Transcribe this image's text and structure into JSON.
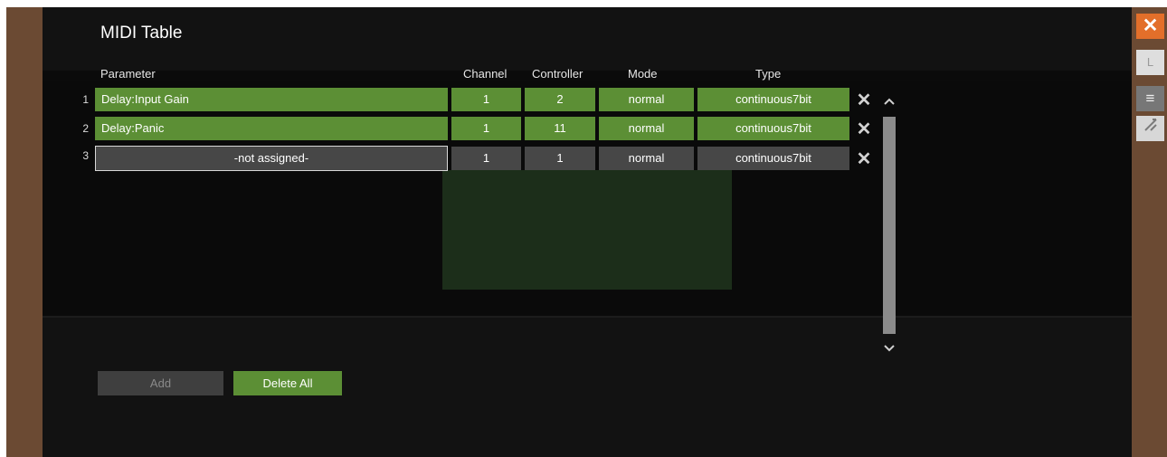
{
  "window": {
    "title": "MIDI Table"
  },
  "columns": {
    "parameter": "Parameter",
    "channel": "Channel",
    "controller": "Controller",
    "mode": "Mode",
    "type": "Type"
  },
  "rows": [
    {
      "num": "1",
      "parameter": "Delay:Input Gain",
      "channel": "1",
      "controller": "2",
      "mode": "normal",
      "type": "continuous7bit",
      "delete_icon": "close-x"
    },
    {
      "num": "2",
      "parameter": "Delay:Panic",
      "channel": "1",
      "controller": "11",
      "mode": "normal",
      "type": "continuous7bit",
      "delete_icon": "close-x"
    },
    {
      "num": "3",
      "parameter": "-not assigned-",
      "channel": "1",
      "controller": "1",
      "mode": "normal",
      "type": "continuous7bit",
      "delete_icon": "close-x"
    }
  ],
  "scrollbar": {
    "up_icon": "chevron-up",
    "down_icon": "chevron-down"
  },
  "buttons": {
    "add": "Add",
    "delete_all": "Delete All"
  },
  "side_toolbar": {
    "close_icon": "close-x",
    "lock_label": "L",
    "menu_icon": "hamburger-menu",
    "tools_icon": "wrench-tools"
  },
  "colors": {
    "brand_orange": "#e36f2a",
    "assigned_green": "#5c8f35",
    "unassigned_gray": "#474747",
    "frame_brown": "#6b4a33",
    "panel_bg": "#121212"
  }
}
